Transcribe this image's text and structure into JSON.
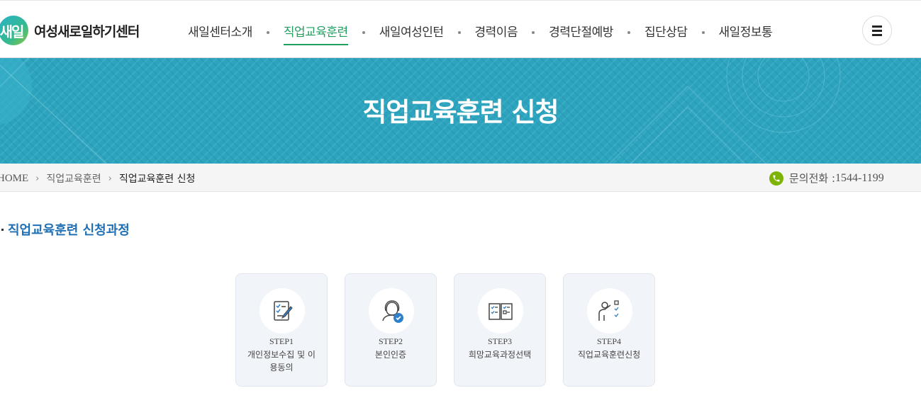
{
  "header": {
    "logo_mark": "새일",
    "logo_text": "여성새로일하기센터",
    "nav": [
      {
        "label": "새일센터소개",
        "active": false
      },
      {
        "label": "직업교육훈련",
        "active": true
      },
      {
        "label": "새일여성인턴",
        "active": false
      },
      {
        "label": "경력이음",
        "active": false
      },
      {
        "label": "경력단절예방",
        "active": false
      },
      {
        "label": "집단상담",
        "active": false
      },
      {
        "label": "새일정보통",
        "active": false
      }
    ],
    "menu_icon": "hamburger-icon"
  },
  "banner": {
    "title": "직업교육훈련 신청"
  },
  "breadcrumb": {
    "home": "HOME",
    "level1": "직업교육훈련",
    "current": "직업교육훈련 신청"
  },
  "contact": {
    "label": "문의전화 : ",
    "number": "1544-1199",
    "icon": "phone-icon"
  },
  "section": {
    "title": "직업교육훈련 신청과정"
  },
  "steps": [
    {
      "label": "STEP1",
      "text": "개인정보수집 및 이용동의",
      "icon": "checklist-pen-icon"
    },
    {
      "label": "STEP2",
      "text": "본인인증",
      "icon": "person-verified-icon"
    },
    {
      "label": "STEP3",
      "text": "희망교육과정선택",
      "icon": "book-checklist-icon"
    },
    {
      "label": "STEP4",
      "text": "직업교육훈련신청",
      "icon": "person-checklist-icon"
    }
  ],
  "colors": {
    "accent_green": "#1f9e5e",
    "banner_teal": "#2ea3bd",
    "link_blue": "#1f6fb5",
    "phone_green": "#7cb305"
  }
}
